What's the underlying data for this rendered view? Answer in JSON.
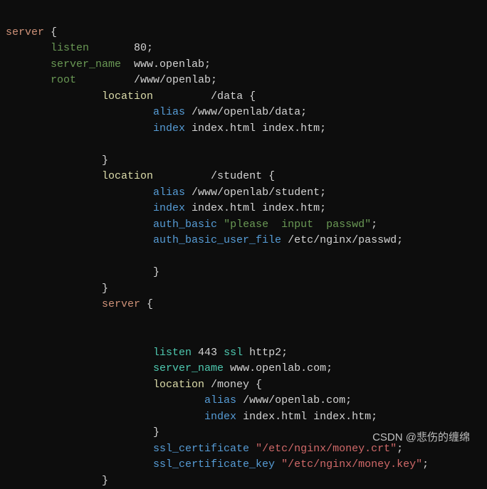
{
  "code": {
    "l1": {
      "a": "server",
      "b": " {"
    },
    "l2": {
      "a": "       listen",
      "b": "       80;"
    },
    "l3": {
      "a": "       server_name",
      "b": "  www.openlab;"
    },
    "l4": {
      "a": "       root",
      "b": "         /www/openlab;"
    },
    "l5": {
      "a": "               location",
      "b": "         /data {"
    },
    "l6": {
      "a": "                       alias",
      "b": " /www/openlab/data;"
    },
    "l7": {
      "a": "                       index",
      "b": " index.html index.htm;"
    },
    "l8": "",
    "l9": "               }",
    "l10": {
      "a": "               location",
      "b": "         /student {"
    },
    "l11": {
      "a": "                       alias",
      "b": " /www/openlab/student;"
    },
    "l12": {
      "a": "                       index",
      "b": " index.html index.htm;"
    },
    "l13": {
      "a": "                       auth_basic",
      "b": " \"please  input  passwd\"",
      "c": ";"
    },
    "l14": {
      "a": "                       auth_basic_user_file",
      "b": " /etc/nginx/passwd;"
    },
    "l15": "",
    "l16": "                       }",
    "l17": "               }",
    "l18": {
      "a": "               server",
      "b": " {"
    },
    "l19": "",
    "l20": "",
    "l21": {
      "a": "                       listen",
      "b": " 443 ",
      "c": "ssl",
      "d": " http2;"
    },
    "l22": {
      "a": "                       server_name",
      "b": " www.openlab.com;"
    },
    "l23": {
      "a": "                       location",
      "b": " /money {"
    },
    "l24": {
      "a": "                               alias",
      "b": " /www/openlab.com;"
    },
    "l25": {
      "a": "                               index",
      "b": " index.html index.htm;"
    },
    "l26": "                       }",
    "l27": {
      "a": "                       ssl_certificate",
      "b": " \"/etc/nginx/money.crt\"",
      "c": ";"
    },
    "l28": {
      "a": "                       ssl_certificate_key",
      "b": " \"/etc/nginx/money.key\"",
      "c": ";"
    },
    "l29": "               }"
  },
  "watermark": "CSDN @悲伤的缠绵"
}
